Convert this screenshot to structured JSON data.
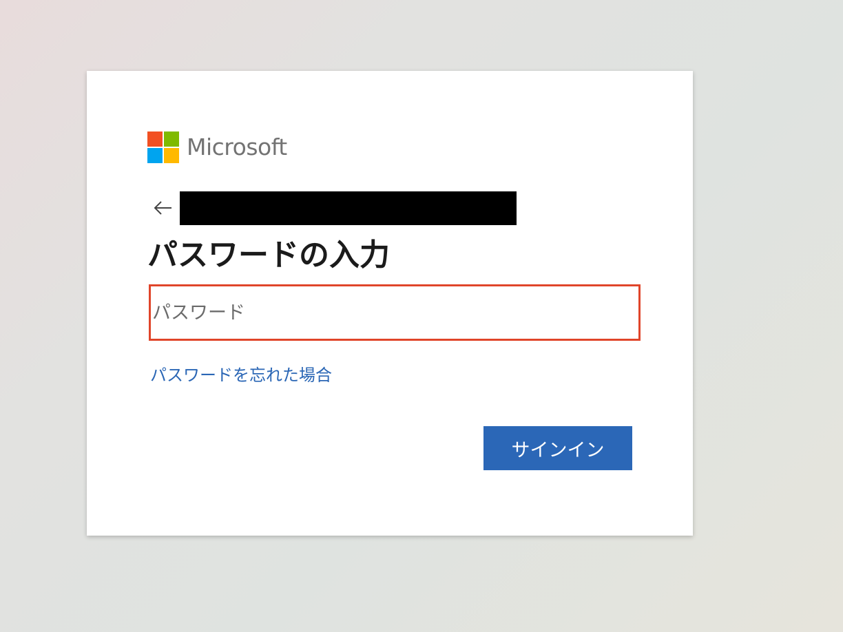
{
  "brand": {
    "name": "Microsoft",
    "colors": {
      "red": "#f25022",
      "green": "#7fba00",
      "blue": "#00a4ef",
      "yellow": "#ffb900",
      "text": "#737373"
    },
    "logo_icon": "microsoft-four-squares-icon"
  },
  "identity": {
    "back_icon": "back-arrow-icon",
    "account_text": ""
  },
  "title": "パスワードの入力",
  "password_field": {
    "value": "",
    "placeholder": "パスワード"
  },
  "forgot_password_link": "パスワードを忘れた場合",
  "signin_button_label": "サインイン",
  "colors": {
    "input_border": "#e0452a",
    "link": "#2a66b5",
    "button_bg": "#2b67b7",
    "button_text": "#ffffff"
  }
}
